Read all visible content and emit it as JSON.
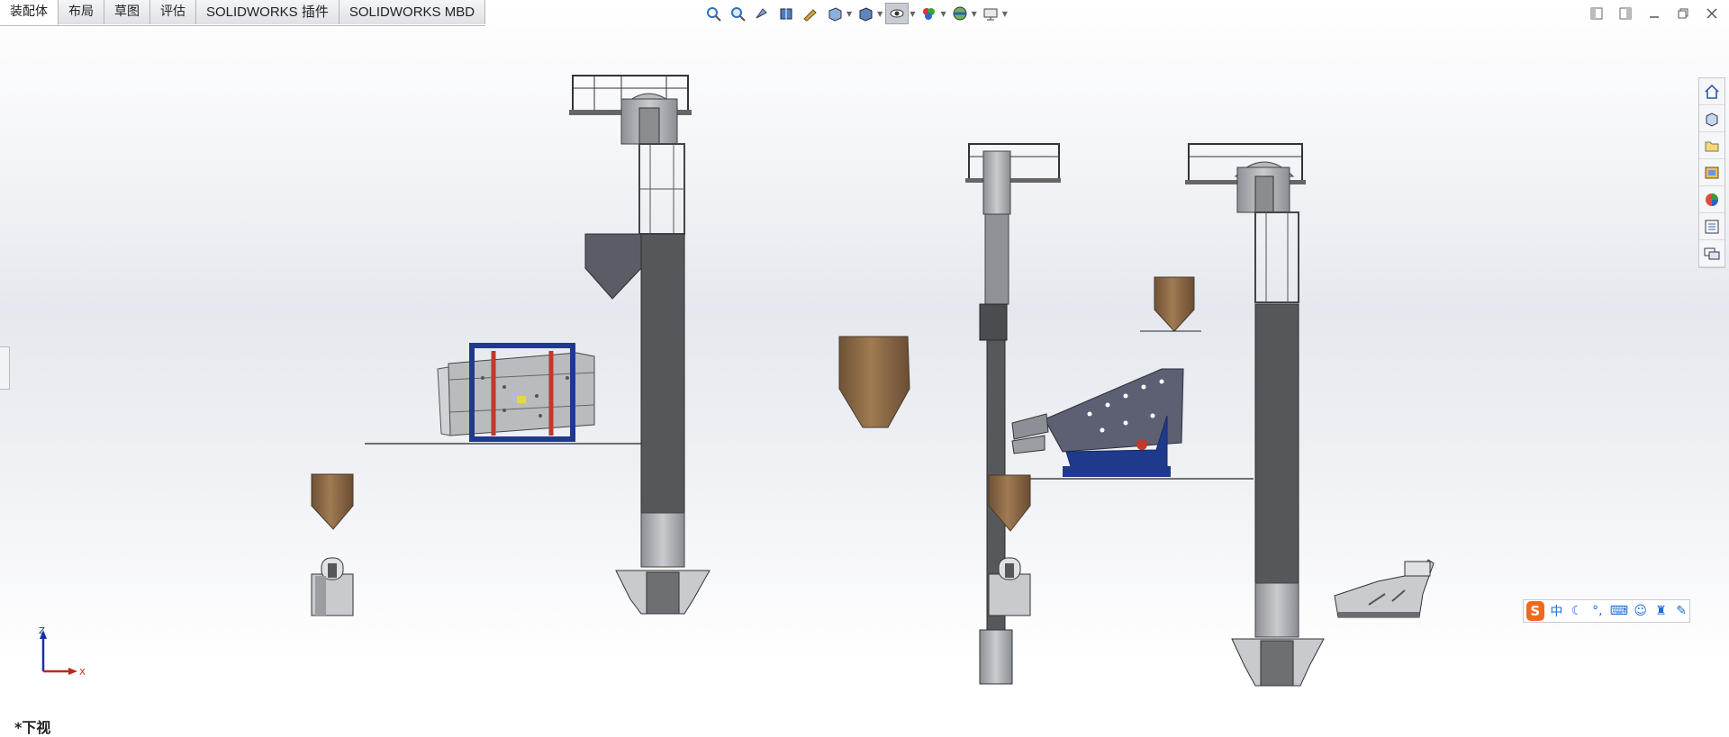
{
  "tabs": [
    "装配体",
    "布局",
    "草图",
    "评估",
    "SOLIDWORKS 插件",
    "SOLIDWORKS MBD"
  ],
  "active_tab": "装配体",
  "heads_up_toolbar": [
    "zoom-to-fit-icon",
    "zoom-to-area-icon",
    "previous-view-icon",
    "section-view-icon",
    "dynamic-annotation-icon",
    "view-orientation-icon",
    "display-style-icon",
    "hide-show-items-icon",
    "edit-appearance-icon",
    "apply-scene-icon",
    "view-settings-icon"
  ],
  "window_controls": [
    "tile-left-icon",
    "tile-right-icon",
    "minimize-icon",
    "restore-icon",
    "close-icon"
  ],
  "task_pane": [
    "home-icon",
    "design-library-icon",
    "file-explorer-icon",
    "view-palette-icon",
    "appearances-icon",
    "custom-properties-icon",
    "forum-icon"
  ],
  "view": {
    "label": "*下视"
  },
  "triad": {
    "z": "Z",
    "x": "X"
  },
  "ime": {
    "logo": "S",
    "mode": "中",
    "items": [
      "moon-icon",
      "punctuation-icon",
      "keyboard-icon",
      "user-icon",
      "skin-icon",
      "wrench-icon"
    ]
  },
  "colors": {
    "tower": "#55565a",
    "hopper": "#8b6845",
    "frame_blue": "#1f3a8c",
    "accent_red": "#c0392b",
    "steel": "#9ea1a6"
  }
}
